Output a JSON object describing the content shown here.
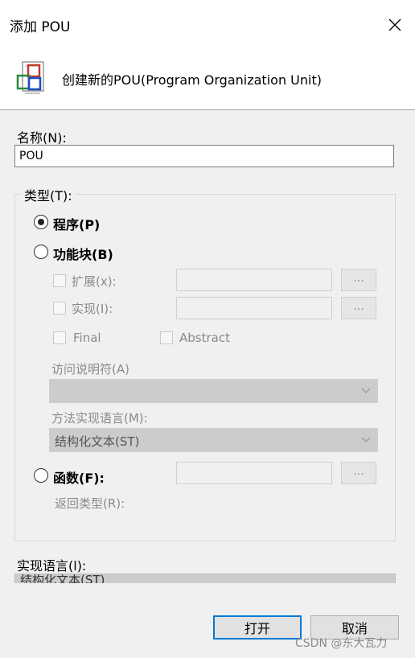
{
  "window": {
    "title": "添加 POU",
    "close_icon": "close-icon"
  },
  "header": {
    "icon": "pou-icon",
    "text": "创建新的POU(Program Organization Unit)"
  },
  "name": {
    "label": "名称(N):",
    "value": "POU"
  },
  "type_group": {
    "title": "类型(T):",
    "program": {
      "label": "程序(P)",
      "selected": true
    },
    "function_block": {
      "label": "功能块(B)",
      "selected": false,
      "extends_label": "扩展(x):",
      "extends_button": "...",
      "implements_label": "实现(I):",
      "implements_button": "...",
      "final_label": "Final",
      "abstract_label": "Abstract",
      "access_label": "访问说明符(A)",
      "access_value": "",
      "method_lang_label": "方法实现语言(M):",
      "method_lang_value": "结构化文本(ST)"
    },
    "function": {
      "label": "函数(F):",
      "selected": false,
      "button": "...",
      "return_type_label": "返回类型(R):"
    }
  },
  "implementation": {
    "label": "实现语言(l):",
    "value": "结构化文本(ST)"
  },
  "buttons": {
    "open": "打开",
    "cancel": "取消"
  },
  "watermark": "CSDN @东大瓦力",
  "colors": {
    "primary_border": "#0078d7",
    "dialog_bg": "#f0f0f0"
  }
}
